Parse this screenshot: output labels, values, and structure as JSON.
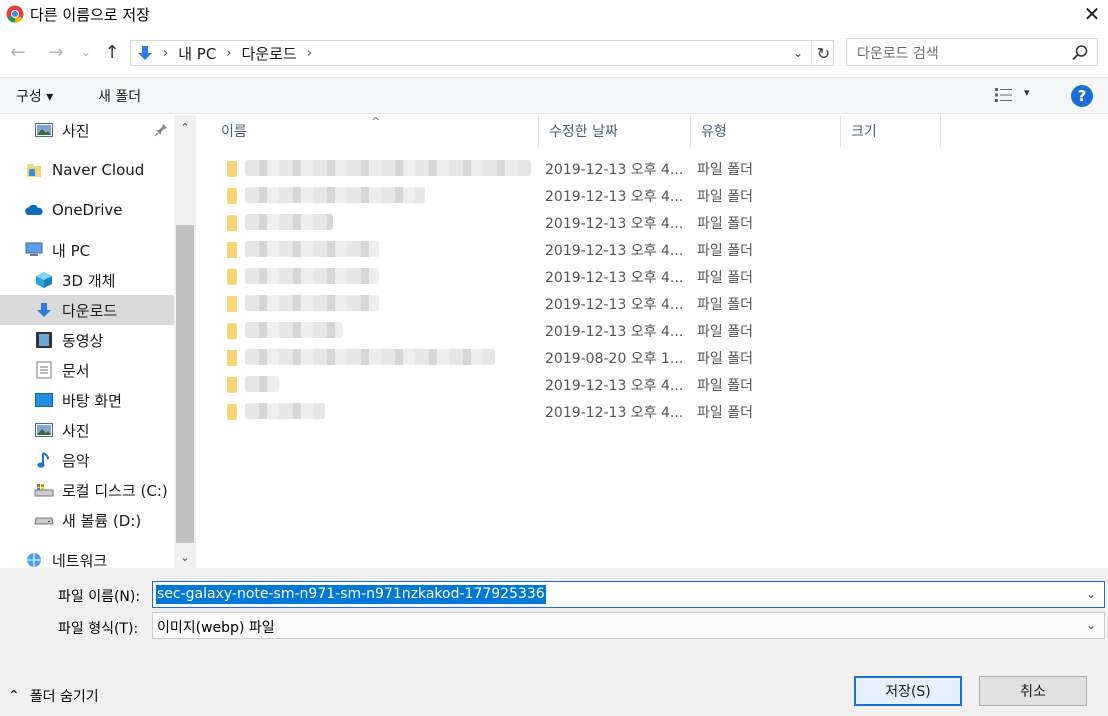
{
  "window": {
    "title": "다른 이름으로 저장",
    "close_glyph": "✕"
  },
  "nav_buttons": {
    "back": "←",
    "forward": "→",
    "recent": "⌄",
    "up": "↑"
  },
  "address": {
    "crumbs": [
      "내 PC",
      "다운로드"
    ],
    "separator": "›",
    "refresh": "↻",
    "dropdown": "⌄"
  },
  "search": {
    "placeholder": "다운로드 검색"
  },
  "toolbar": {
    "organize": "구성 ▾",
    "new_folder": "새 폴더",
    "view_dropdown": "▾",
    "help": "?"
  },
  "sidebar": {
    "items": [
      {
        "label": "사진",
        "icon": "pictures-icon"
      },
      {
        "label": "Naver Cloud",
        "icon": "naver-cloud-icon"
      },
      {
        "label": "OneDrive",
        "icon": "onedrive-icon"
      },
      {
        "label": "내 PC",
        "icon": "pc-icon"
      },
      {
        "label": "3D 개체",
        "icon": "3d-objects-icon"
      },
      {
        "label": "다운로드",
        "icon": "download-icon",
        "selected": true
      },
      {
        "label": "동영상",
        "icon": "videos-icon"
      },
      {
        "label": "문서",
        "icon": "documents-icon"
      },
      {
        "label": "바탕 화면",
        "icon": "desktop-icon"
      },
      {
        "label": "사진",
        "icon": "pictures-icon"
      },
      {
        "label": "음악",
        "icon": "music-icon"
      },
      {
        "label": "로컬 디스크 (C:)",
        "icon": "local-disk-icon"
      },
      {
        "label": "새 볼륨 (D:)",
        "icon": "drive-icon"
      },
      {
        "label": "네트워크",
        "icon": "network-icon"
      }
    ],
    "scroll_up": "⌃",
    "scroll_down": "⌄"
  },
  "filelist": {
    "columns": [
      "이름",
      "수정한 날짜",
      "유형",
      "크기"
    ],
    "rows": [
      {
        "date": "2019-12-13 오후 4...",
        "type": "파일 폴더"
      },
      {
        "date": "2019-12-13 오후 4...",
        "type": "파일 폴더"
      },
      {
        "date": "2019-12-13 오후 4...",
        "type": "파일 폴더"
      },
      {
        "date": "2019-12-13 오후 4...",
        "type": "파일 폴더"
      },
      {
        "date": "2019-12-13 오후 4...",
        "type": "파일 폴더"
      },
      {
        "date": "2019-12-13 오후 4...",
        "type": "파일 폴더"
      },
      {
        "date": "2019-12-13 오후 4...",
        "type": "파일 폴더"
      },
      {
        "date": "2019-08-20 오후 1...",
        "type": "파일 폴더"
      },
      {
        "date": "2019-12-13 오후 4...",
        "type": "파일 폴더"
      },
      {
        "date": "2019-12-13 오후 4...",
        "type": "파일 폴더"
      }
    ]
  },
  "bottom": {
    "filename_label": "파일 이름(N):",
    "filename_value": "sec-galaxy-note-sm-n971-sm-n971nzkakod-177925336",
    "filetype_label": "파일 형식(T):",
    "filetype_value": "이미지(webp) 파일",
    "hide_folders": "폴더 숨기기",
    "save_button": "저장(S)",
    "cancel_button": "취소"
  },
  "colors": {
    "accent": "#1c6ed1",
    "selection": "#0078d7",
    "folder": "#f5d67b"
  }
}
